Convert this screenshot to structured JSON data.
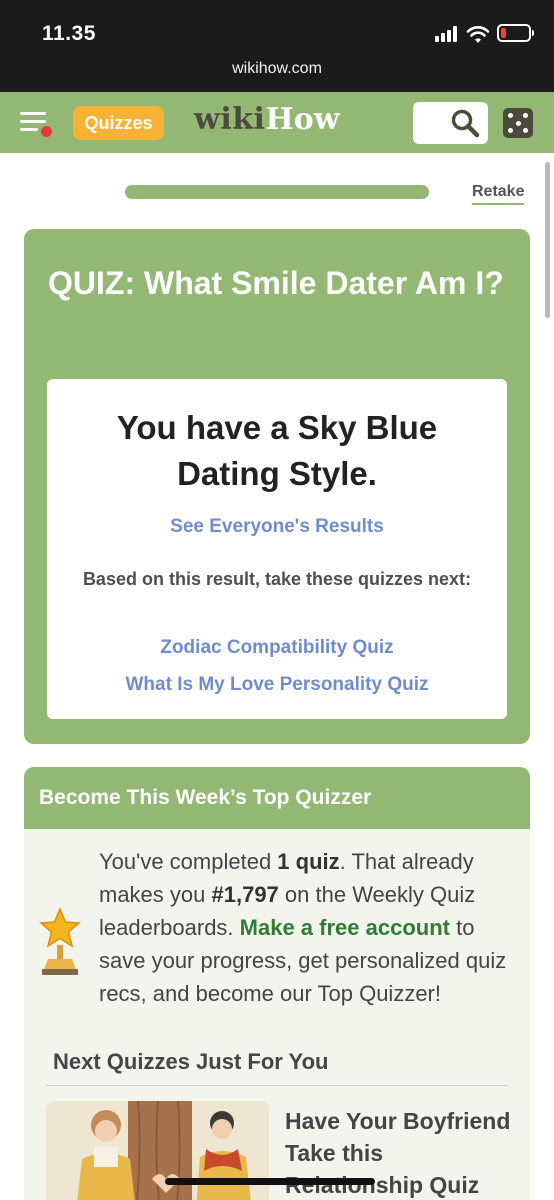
{
  "status_bar": {
    "time": "11.35",
    "url": "wikihow.com",
    "battery_level": 0.15,
    "battery_color": "#ff3b30"
  },
  "header": {
    "menu_icon": "hamburger-menu-icon",
    "quizzes_label": "Quizzes",
    "logo_part1": "wiki",
    "logo_part2": "How",
    "search_icon": "search-icon",
    "random_icon": "dice-icon",
    "brand_color": "#93b874",
    "accent_color": "#f9b233"
  },
  "progress": {
    "value": 1.0,
    "retake_label": "Retake"
  },
  "quiz": {
    "title": "QUIZ: What Smile Dater Am I?",
    "result_title": "You have a Sky Blue Dating Style.",
    "see_results_link": "See Everyone's Results",
    "based_text": "Based on this result, take these quizzes next:",
    "suggestions": [
      "Zodiac Compatibility Quiz",
      "What Is My Love Personality Quiz"
    ],
    "link_color": "#6f8ccf"
  },
  "top_quizzer": {
    "heading": "Become This Week’s Top Quizzer",
    "text_part1": "You've completed ",
    "quiz_count": "1 quiz",
    "text_part2": ". That already makes you ",
    "rank": "#1,797",
    "text_part3": " on the Weekly Quiz leaderboards. ",
    "account_link": "Make a free account",
    "text_part4": " to save your progress, get personalized quiz recs, and become our Top Quizzer!",
    "trophy_icon": "trophy-star-icon"
  },
  "next_quizzes": {
    "heading": "Next Quizzes Just For You",
    "items": [
      {
        "title": "Have Your Boyfriend Take this Relationship Quiz"
      }
    ]
  }
}
